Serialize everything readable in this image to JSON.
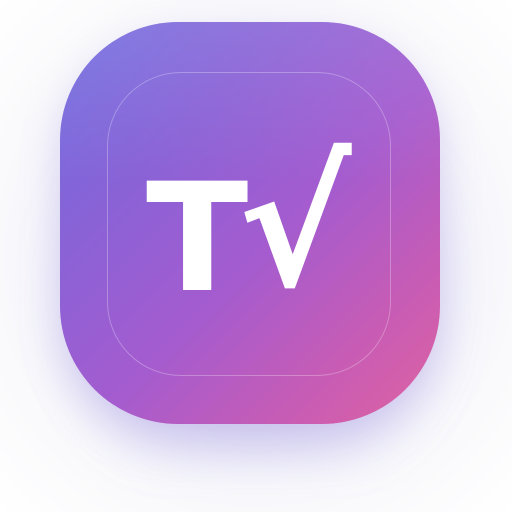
{
  "app_icon": {
    "glyph_letter": "T",
    "glyph_check": "√",
    "colors": {
      "gradient_start": "#6f6ee0",
      "gradient_mid": "#a45ccf",
      "gradient_end": "#e063a0",
      "glyph": "#ffffff"
    }
  }
}
